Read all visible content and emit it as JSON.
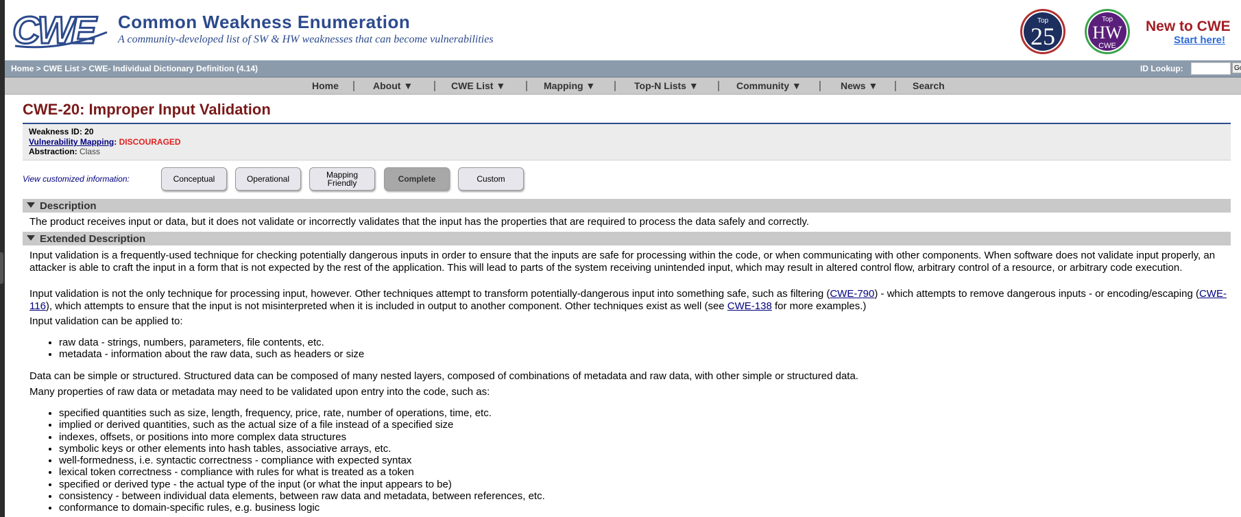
{
  "header": {
    "logo_text": "CWE",
    "site_title": "Common Weakness Enumeration",
    "site_subtitle": "A community-developed list of SW & HW weaknesses that can become vulnerabilities",
    "badge_top25": {
      "top": "Top",
      "num": "25"
    },
    "badge_hw": {
      "top": "Top",
      "main": "HW",
      "sub": "CWE"
    },
    "new_to": "New to CWE",
    "start_here": "Start here!"
  },
  "breadcrumb": {
    "text": "Home > CWE List > CWE- Individual Dictionary Definition (4.14)",
    "id_lookup_label": "ID Lookup:",
    "go_label": "Go"
  },
  "nav": {
    "items": [
      {
        "label": "Home"
      },
      {
        "label": "About  ▼"
      },
      {
        "label": "CWE List  ▼"
      },
      {
        "label": "Mapping  ▼"
      },
      {
        "label": "Top-N Lists  ▼"
      },
      {
        "label": "Community  ▼"
      },
      {
        "label": "News  ▼"
      },
      {
        "label": "Search"
      }
    ]
  },
  "cwe": {
    "title": "CWE-20: Improper Input Validation",
    "weakness_id_label": "Weakness ID:",
    "weakness_id": "20",
    "vuln_mapping_label": "Vulnerability Mapping",
    "vuln_mapping_value": "DISCOURAGED",
    "abstraction_label": "Abstraction:",
    "abstraction_value": "Class"
  },
  "view": {
    "label": "View customized information:",
    "buttons": [
      {
        "label": "Conceptual"
      },
      {
        "label": "Operational"
      },
      {
        "label": "Mapping Friendly"
      },
      {
        "label": "Complete",
        "active": true
      },
      {
        "label": "Custom"
      }
    ]
  },
  "description": {
    "heading": "Description",
    "text": "The product receives input or data, but it does not validate or incorrectly validates that the input has the properties that are required to process the data safely and correctly."
  },
  "extended": {
    "heading": "Extended Description",
    "p1": "Input validation is a frequently-used technique for checking potentially dangerous inputs in order to ensure that the inputs are safe for processing within the code, or when communicating with other components. When software does not validate input properly, an attacker is able to craft the input in a form that is not expected by the rest of the application. This will lead to parts of the system receiving unintended input, which may result in altered control flow, arbitrary control of a resource, or arbitrary code execution.",
    "p2_a": "Input validation is not the only technique for processing input, however. Other techniques attempt to transform potentially-dangerous input into something safe, such as filtering (",
    "p2_link1": "CWE-790",
    "p2_b": ") - which attempts to remove dangerous inputs - or encoding/escaping (",
    "p2_link2": "CWE-116",
    "p2_c": "), which attempts to ensure that the input is not misinterpreted when it is included in output to another component. Other techniques exist as well (see ",
    "p2_link3": "CWE-138",
    "p2_d": " for more examples.)",
    "p3": "Input validation can be applied to:",
    "list1": [
      "raw data - strings, numbers, parameters, file contents, etc.",
      "metadata - information about the raw data, such as headers or size"
    ],
    "p4": "Data can be simple or structured. Structured data can be composed of many nested layers, composed of combinations of metadata and raw data, with other simple or structured data.",
    "p5": "Many properties of raw data or metadata may need to be validated upon entry into the code, such as:",
    "list2": [
      "specified quantities such as size, length, frequency, price, rate, number of operations, time, etc.",
      "implied or derived quantities, such as the actual size of a file instead of a specified size",
      "indexes, offsets, or positions into more complex data structures",
      "symbolic keys or other elements into hash tables, associative arrays, etc.",
      "well-formedness, i.e. syntactic correctness - compliance with expected syntax",
      "lexical token correctness - compliance with rules for what is treated as a token",
      "specified or derived type - the actual type of the input (or what the input appears to be)",
      "consistency - between individual data elements, between raw data and metadata, between references, etc.",
      "conformance to domain-specific rules, e.g. business logic"
    ]
  }
}
